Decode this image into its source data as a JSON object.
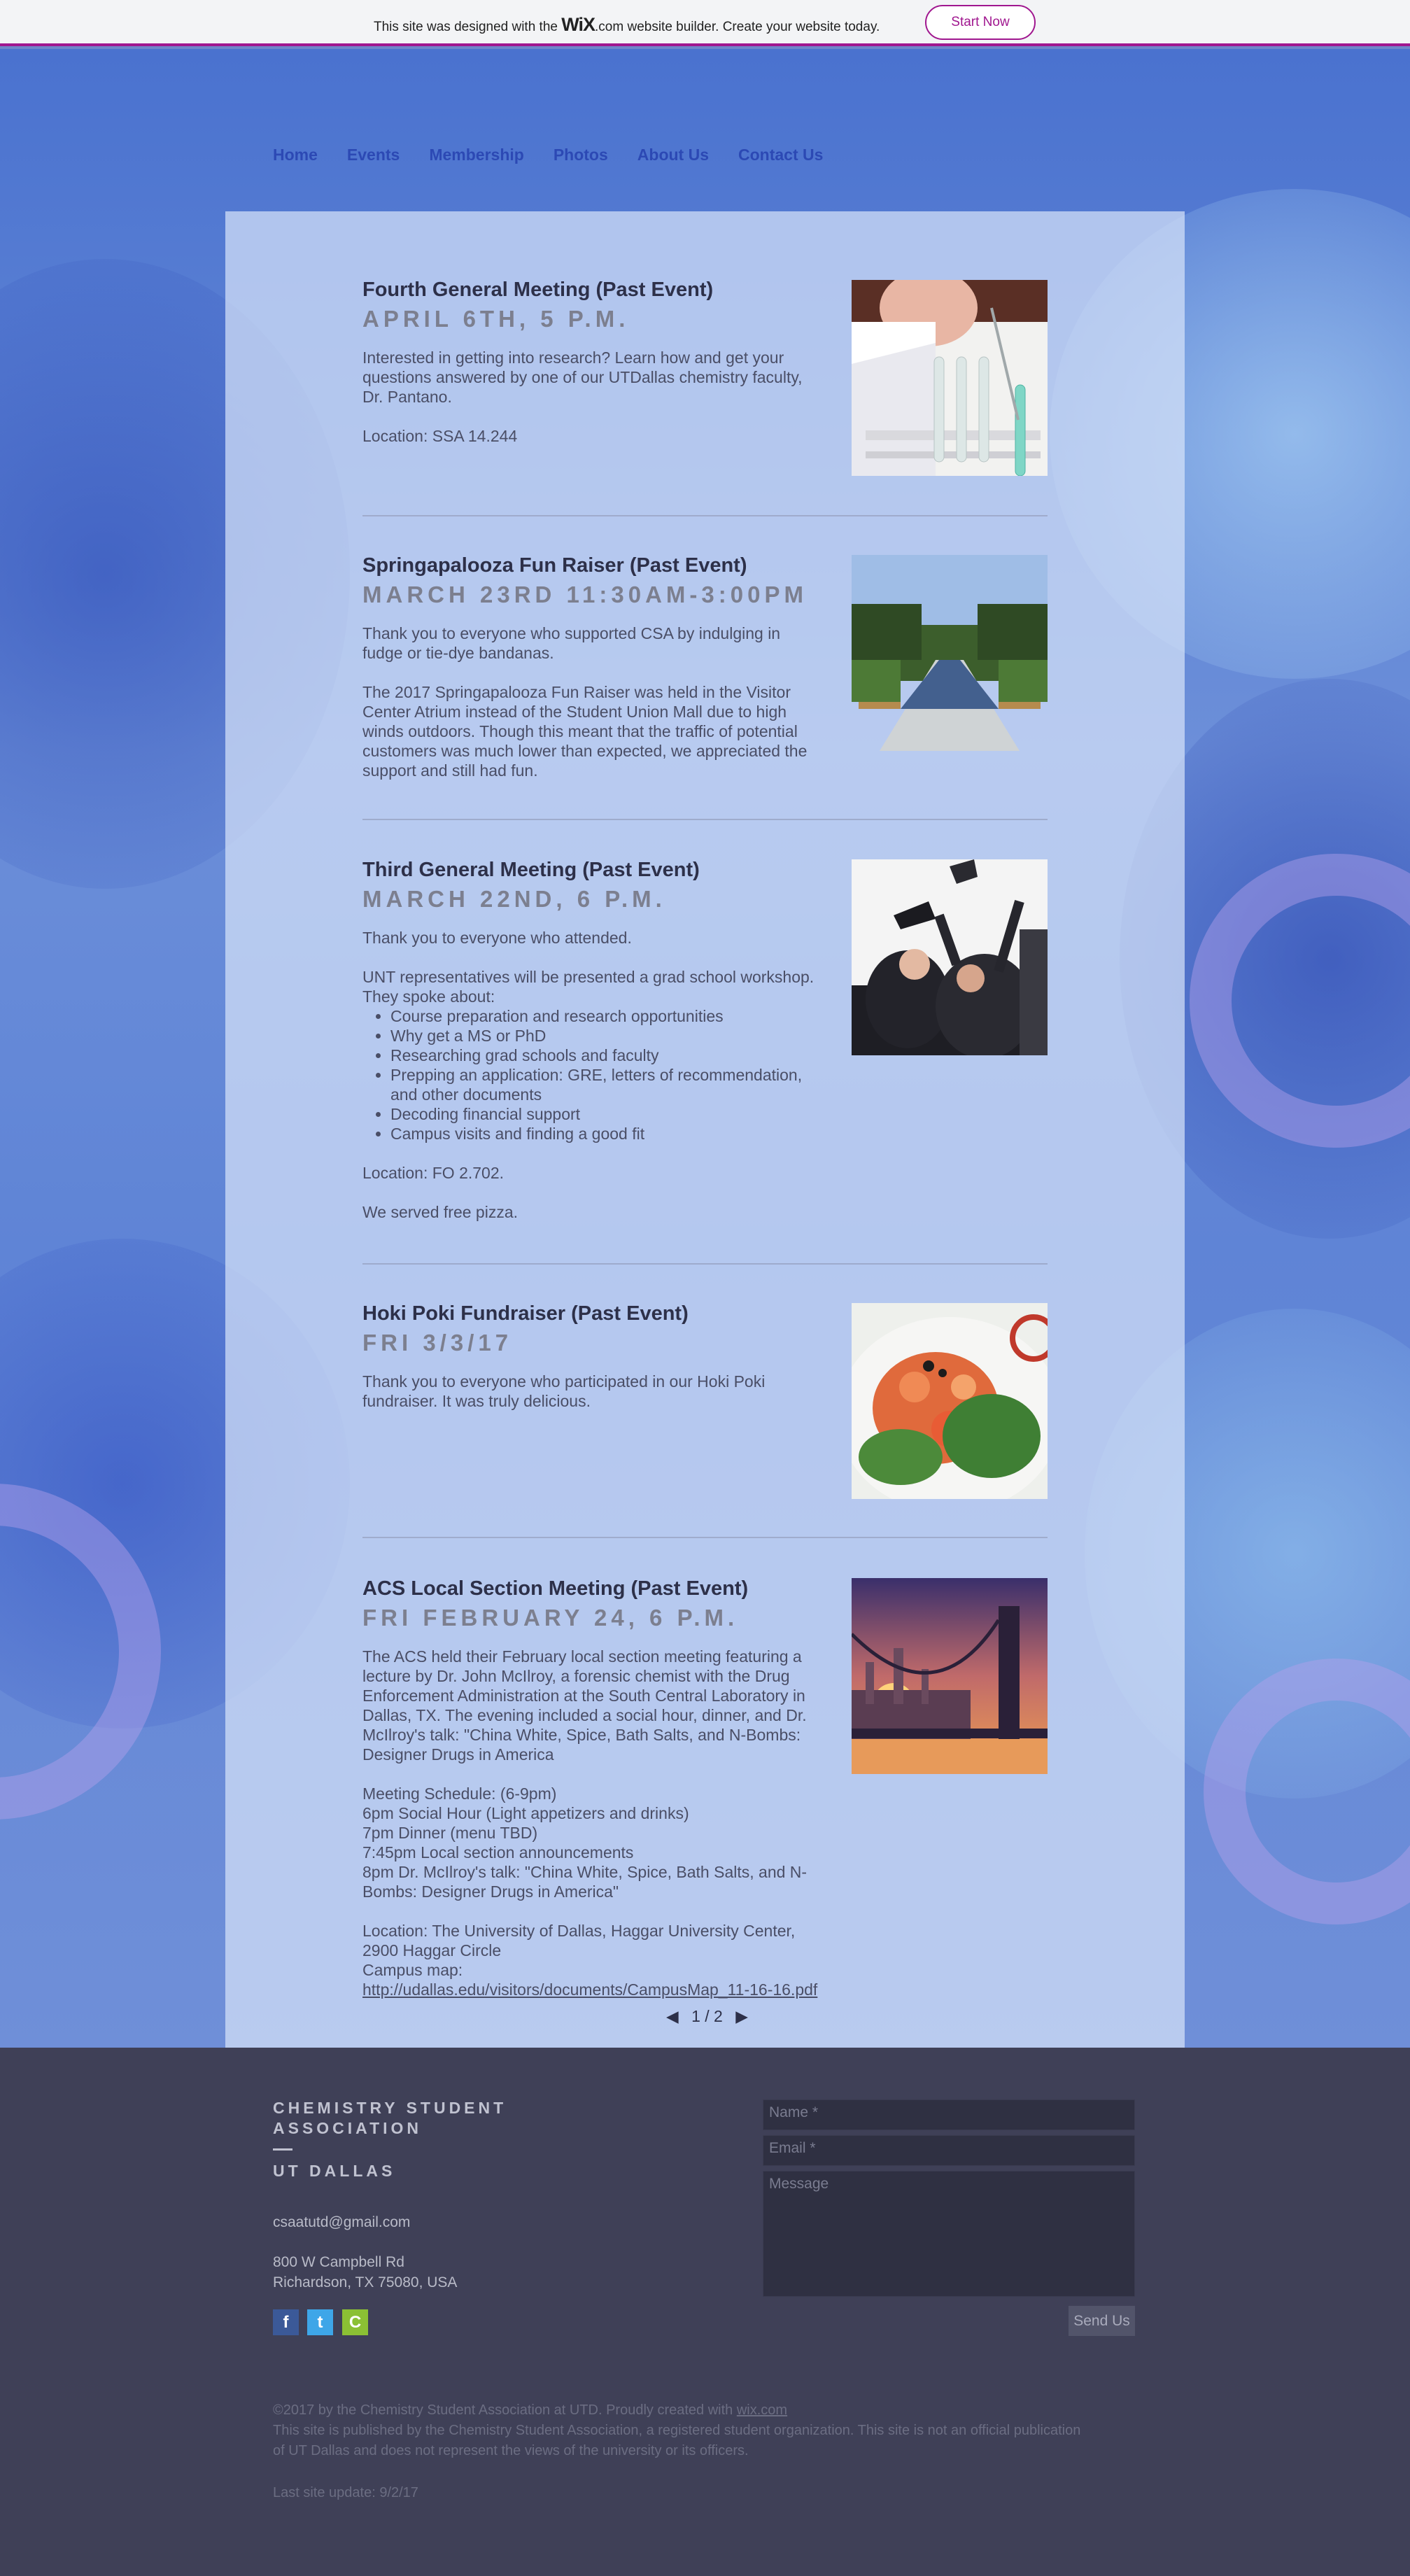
{
  "banner": {
    "text_before": "This site was designed with the ",
    "brand": "WiX",
    "text_after": ".com website builder. Create your website today.",
    "button_label": "Start Now"
  },
  "nav": {
    "items": [
      "Home",
      "Events",
      "Membership",
      "Photos",
      "About Us",
      "Contact Us"
    ]
  },
  "events": [
    {
      "title": "Fourth General Meeting (Past Event)",
      "date": "APRIL 6TH, 5 P.M.",
      "lines": [
        "Interested in getting into research? Learn how and get your questions answered by one of our UTDallas chemistry faculty, Dr. Pantano.",
        "",
        "Location: SSA 14.244"
      ],
      "image": "test-tubes-photo"
    },
    {
      "title": "Springapalooza Fun Raiser (Past Event)",
      "date": "MARCH 23RD 11:30AM-3:00PM",
      "lines": [
        "Thank you to everyone who supported CSA by indulging in fudge or tie-dye bandanas.",
        "",
        "The 2017 Springapalooza Fun Raiser was held in the Visitor Center Atrium instead of the Student Union Mall due to high winds outdoors. Though this meant that the traffic of potential customers was much lower than expected, we appreciated the support and still had fun."
      ],
      "image": "reflecting-pool-photo"
    },
    {
      "title": "Third General Meeting (Past Event)",
      "date": "MARCH 22ND, 6 P.M.",
      "intro": [
        "Thank you to everyone who attended.",
        "",
        "UNT representatives will be presented a grad school workshop. They spoke about:"
      ],
      "bullets": [
        "Course preparation and research opportunities",
        "Why get a MS or PhD",
        "Researching grad schools and faculty",
        "Prepping an application: GRE, letters of recommendation, and other documents",
        "Decoding financial support",
        "Campus visits and finding a good fit"
      ],
      "outro": [
        "",
        "Location: FO 2.702.",
        "",
        "We served free pizza."
      ],
      "image": "graduation-photo"
    },
    {
      "title": "Hoki Poki Fundraiser (Past Event)",
      "date": "FRI 3/3/17",
      "lines": [
        "Thank you to everyone who participated in our Hoki Poki fundraiser. It was truly delicious."
      ],
      "image": "poke-bowl-photo"
    },
    {
      "title": "ACS Local Section Meeting (Past Event)",
      "date": "FRI FEBRUARY 24, 6 P.M.",
      "lines": [
        "The ACS held their February local section meeting featuring a lecture by Dr. John McIlroy, a forensic chemist with the Drug Enforcement Administration at the South Central Laboratory in Dallas, TX. The evening included a social hour, dinner, and Dr. McIlroy's talk: \"China White, Spice, Bath Salts, and N-Bombs: Designer Drugs in America",
        "",
        "Meeting Schedule: (6-9pm)",
        "6pm Social Hour (Light appetizers and drinks)",
        "7pm Dinner (menu TBD)",
        "7:45pm Local section announcements",
        "8pm Dr. McIlroy's talk: \"China White, Spice, Bath Salts, and N-Bombs: Designer Drugs in America\"",
        "",
        "Location: The University of Dallas, Haggar University Center, 2900 Haggar Circle",
        "Campus map:"
      ],
      "link": "http://udallas.edu/visitors/documents/CampusMap_11-16-16.pdf",
      "image": "bridge-sunset-photo"
    }
  ],
  "pager": {
    "prev": "◀",
    "label": "1 / 2",
    "next": "▶"
  },
  "footer": {
    "org_name": "CHEMISTRY STUDENT ASSOCIATION",
    "org_sub": "UT DALLAS",
    "email": "csaatutd@gmail.com",
    "address_line1": "800 W Campbell Rd",
    "address_line2": "Richardson, TX 75080, USA",
    "social": [
      {
        "icon": "facebook-icon",
        "glyph": "f",
        "color": "#3b5998"
      },
      {
        "icon": "twitter-icon",
        "glyph": "t",
        "color": "#3ea6e8"
      },
      {
        "icon": "campuslabs-icon",
        "glyph": "C",
        "color": "#8bc034"
      }
    ],
    "form": {
      "name_placeholder": "Name *",
      "email_placeholder": "Email *",
      "message_placeholder": "Message",
      "send_label": "Send Us"
    },
    "copyright": "©2017 by the Chemistry Student Association at UTD. Proudly created with ",
    "copyright_link": "wix.com",
    "disclaimer_line1": "This site is published by the Chemistry Student Association, a registered student organization. This site is not an official publication",
    "disclaimer_line2": "of UT Dallas and does not represent the views of the university or its officers.",
    "last_update": "Last site update: 9/2/17"
  }
}
